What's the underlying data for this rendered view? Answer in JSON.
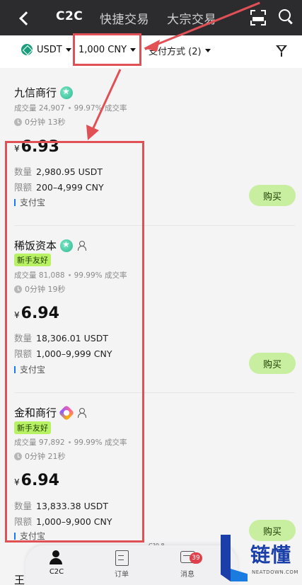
{
  "header": {
    "tabs": [
      {
        "label": "C2C",
        "active": true
      },
      {
        "label": "快捷交易",
        "active": false
      },
      {
        "label": "大宗交易",
        "active": false
      }
    ]
  },
  "filters": {
    "coin": "USDT",
    "amount": "1,000 CNY",
    "payment": "支付方式 (2)"
  },
  "listings": [
    {
      "merchant": "九信商行",
      "newbie": "",
      "volume": "成交量 24,907",
      "rate": "99.97% 成交率",
      "time": "0分钟 13秒",
      "currency_symbol": "¥",
      "price": "6.93",
      "quantity_label": "数量",
      "quantity": "2,980.95 USDT",
      "limit_label": "限额",
      "limit": "200–4,999 CNY",
      "payment": "支付宝",
      "buy_label": "购买"
    },
    {
      "merchant": "稀饭资本",
      "newbie": "新手友好",
      "volume": "成交量 81,088",
      "rate": "99.99% 成交率",
      "time": "0分钟 19秒",
      "currency_symbol": "¥",
      "price": "6.94",
      "quantity_label": "数量",
      "quantity": "18,306.01 USDT",
      "limit_label": "限额",
      "limit": "1,000–9,999 CNY",
      "payment": "支付宝",
      "buy_label": "购买"
    },
    {
      "merchant": "金和商行",
      "newbie": "新手友好",
      "volume": "成交量 97,892",
      "rate": "99.99% 成交率",
      "time": "0分钟 21秒",
      "currency_symbol": "¥",
      "price": "6.94",
      "quantity_label": "数量",
      "quantity": "13,833.38 USDT",
      "limit_label": "限额",
      "limit": "1,000–9,900 CNY",
      "payment": "支付宝",
      "buy_label": "购买"
    }
  ],
  "partial_merchant": "王",
  "tiny_label": "C?0.8",
  "bottom_nav": {
    "items": [
      {
        "label": "C2C",
        "icon": "user-icon"
      },
      {
        "label": "订单",
        "icon": "order-icon"
      },
      {
        "label": "消息",
        "icon": "message-icon"
      }
    ],
    "message_badge": "39"
  },
  "watermark": {
    "text": "链懂",
    "sub": "NEATDOWN.COM"
  },
  "colors": {
    "header_bg": "#2c2c2e",
    "highlight": "#e05055",
    "buy_button": "#c8ef9f",
    "newbie_badge": "#b8f264"
  }
}
